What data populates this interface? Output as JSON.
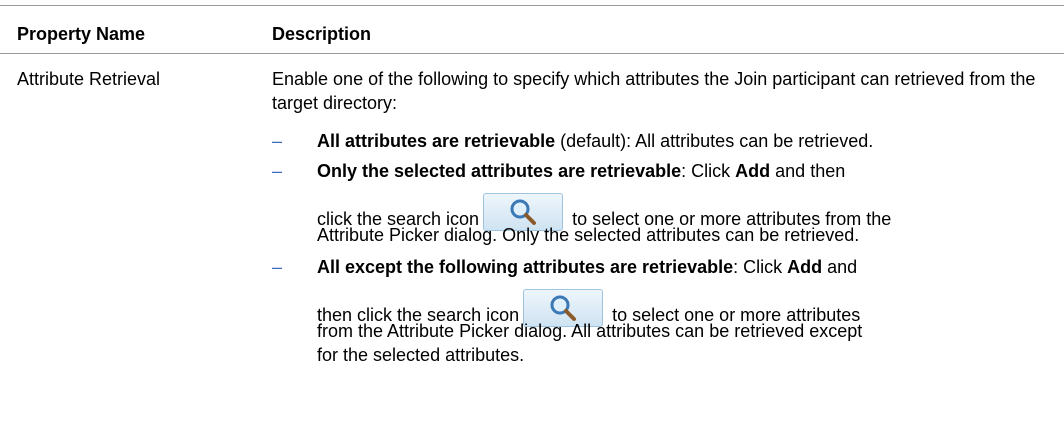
{
  "table": {
    "headers": [
      "Property Name",
      "Description"
    ],
    "row": {
      "property": "Attribute Retrieval",
      "intro": "Enable one of the following to specify which attributes the Join participant can retrieved from the target directory:",
      "bullet": "–",
      "items": [
        {
          "bold": "All attributes are retrievable",
          "rest": " (default): All attributes can be retrieved."
        },
        {
          "bold": "Only the selected attributes are retrievable",
          "after_bold": ": Click ",
          "add": "Add",
          "after_add": " and then",
          "pre_icon": "click the search icon",
          "post_icon": " to select one or more attributes from the",
          "tail": "Attribute Picker dialog. Only the selected attributes can be retrieved."
        },
        {
          "bold": "All except the following attributes are retrievable",
          "after_bold": ": Click ",
          "add": "Add",
          "after_add": " and",
          "pre_icon": "then click the search icon",
          "post_icon": " to select one or more attributes",
          "tail1": "from the Attribute Picker dialog. All attributes can be retrieved except",
          "tail2": "for the selected attributes."
        }
      ]
    }
  },
  "icons": {
    "search": "search-icon"
  },
  "colors": {
    "rule": "#9a9a9a",
    "dash": "#3a6bc0",
    "icon_bg": "#cfe3f2"
  }
}
